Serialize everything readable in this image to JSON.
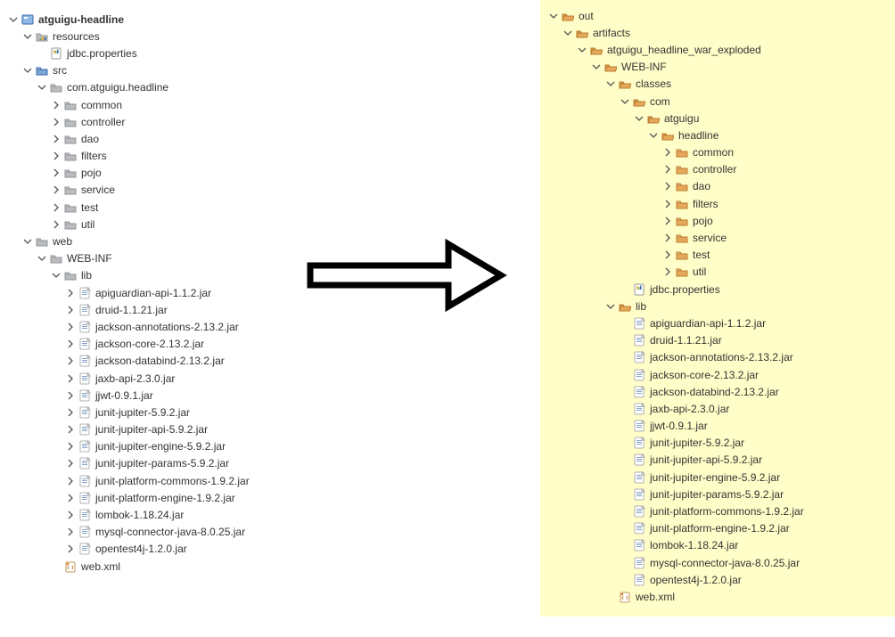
{
  "left_tree": {
    "root": "atguigu-headline",
    "resources": "resources",
    "jdbc": "jdbc.properties",
    "src": "src",
    "pkg": "com.atguigu.headline",
    "pkgs": [
      "common",
      "controller",
      "dao",
      "filters",
      "pojo",
      "service",
      "test",
      "util"
    ],
    "web": "web",
    "webinf": "WEB-INF",
    "lib": "lib",
    "jars": [
      "apiguardian-api-1.1.2.jar",
      "druid-1.1.21.jar",
      "jackson-annotations-2.13.2.jar",
      "jackson-core-2.13.2.jar",
      "jackson-databind-2.13.2.jar",
      "jaxb-api-2.3.0.jar",
      "jjwt-0.9.1.jar",
      "junit-jupiter-5.9.2.jar",
      "junit-jupiter-api-5.9.2.jar",
      "junit-jupiter-engine-5.9.2.jar",
      "junit-jupiter-params-5.9.2.jar",
      "junit-platform-commons-1.9.2.jar",
      "junit-platform-engine-1.9.2.jar",
      "lombok-1.18.24.jar",
      "mysql-connector-java-8.0.25.jar",
      "opentest4j-1.2.0.jar"
    ],
    "webxml": "web.xml"
  },
  "right_tree": {
    "out": "out",
    "artifacts": "artifacts",
    "artifact": "atguigu_headline_war_exploded",
    "webinf": "WEB-INF",
    "classes": "classes",
    "com": "com",
    "atguigu": "atguigu",
    "headline": "headline",
    "pkgs": [
      "common",
      "controller",
      "dao",
      "filters",
      "pojo",
      "service",
      "test",
      "util"
    ],
    "jdbc": "jdbc.properties",
    "lib": "lib",
    "jars": [
      "apiguardian-api-1.1.2.jar",
      "druid-1.1.21.jar",
      "jackson-annotations-2.13.2.jar",
      "jackson-core-2.13.2.jar",
      "jackson-databind-2.13.2.jar",
      "jaxb-api-2.3.0.jar",
      "jjwt-0.9.1.jar",
      "junit-jupiter-5.9.2.jar",
      "junit-jupiter-api-5.9.2.jar",
      "junit-jupiter-engine-5.9.2.jar",
      "junit-jupiter-params-5.9.2.jar",
      "junit-platform-commons-1.9.2.jar",
      "junit-platform-engine-1.9.2.jar",
      "lombok-1.18.24.jar",
      "mysql-connector-java-8.0.25.jar",
      "opentest4j-1.2.0.jar"
    ],
    "webxml": "web.xml"
  }
}
